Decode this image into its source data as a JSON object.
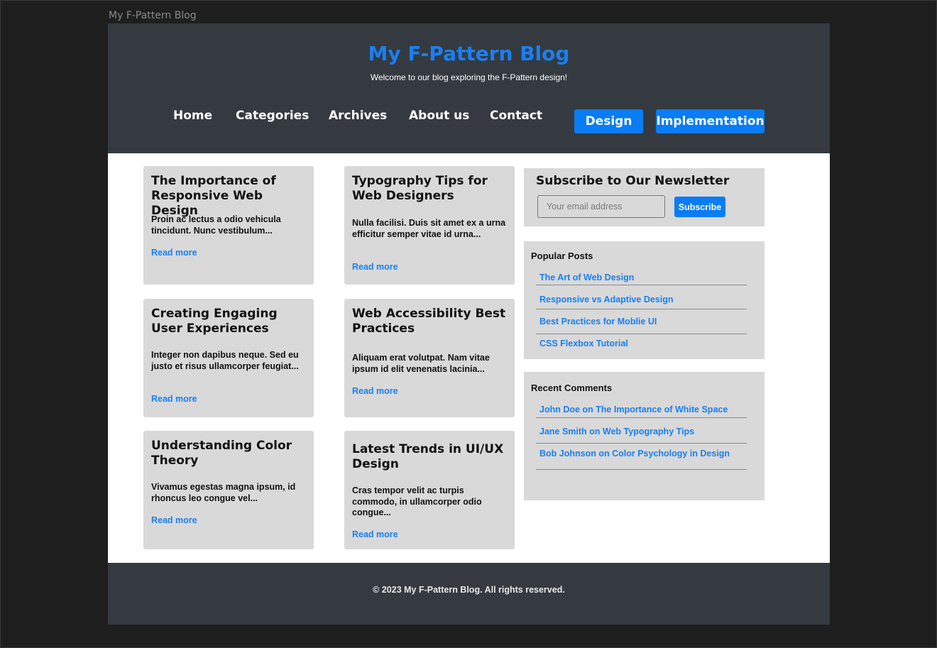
{
  "frame_label": "My F-Pattern Blog",
  "header": {
    "title": "My F-Pattern Blog",
    "tagline": "Welcome to our blog exploring the F-Pattern design!"
  },
  "nav": {
    "links": [
      "Home",
      "Categories",
      "Archives",
      "About us",
      "Contact"
    ],
    "buttons": [
      "Design",
      "Implementation"
    ]
  },
  "posts": [
    {
      "title": "The Importance of Responsive Web Design",
      "excerpt": "Proin ac lectus a odio vehicula tincidunt. Nunc vestibulum...",
      "read_more": "Read more"
    },
    {
      "title": "Typography Tips for Web Designers",
      "excerpt": "Nulla facilisi. Duis sit amet ex a urna efficitur semper vitae id urna...",
      "read_more": "Read more"
    },
    {
      "title": "Creating Engaging User Experiences",
      "excerpt": "Integer non dapibus neque. Sed eu justo et risus ullamcorper feugiat...",
      "read_more": "Read more"
    },
    {
      "title": "Web Accessibility Best Practices",
      "excerpt": "Aliquam erat volutpat. Nam vitae ipsum id elit venenatis lacinia...",
      "read_more": "Read more"
    },
    {
      "title": "Understanding Color Theory",
      "excerpt": "Vivamus egestas magna ipsum, id rhoncus leo congue vel...",
      "read_more": "Read more"
    },
    {
      "title": "Latest Trends in UI/UX Design",
      "excerpt": "Cras tempor velit ac turpis commodo, in ullamcorper odio congue...",
      "read_more": "Read more"
    }
  ],
  "newsletter": {
    "title": "Subscribe to Our Newsletter",
    "placeholder": "Your email address",
    "button": "Subscribe"
  },
  "popular_posts": {
    "title": "Popular Posts",
    "items": [
      "The Art of Web Design",
      "Responsive vs Adaptive Design",
      "Best Practices for Moblie UI",
      "CSS Flexbox Tutorial"
    ]
  },
  "recent_comments": {
    "title": "Recent Comments",
    "items": [
      "John Doe on The Importance of White Space",
      "Jane Smith on Web Typography Tips",
      "Bob Johnson on Color Psychology in Design"
    ]
  },
  "footer": {
    "text": "© 2023 My F-Pattern Blog. All rights reserved."
  },
  "colors": {
    "accent": "#0a7cf5",
    "header_bg": "#343a40",
    "card_bg": "#d9d9d9",
    "canvas_bg": "#1e1e1e"
  }
}
